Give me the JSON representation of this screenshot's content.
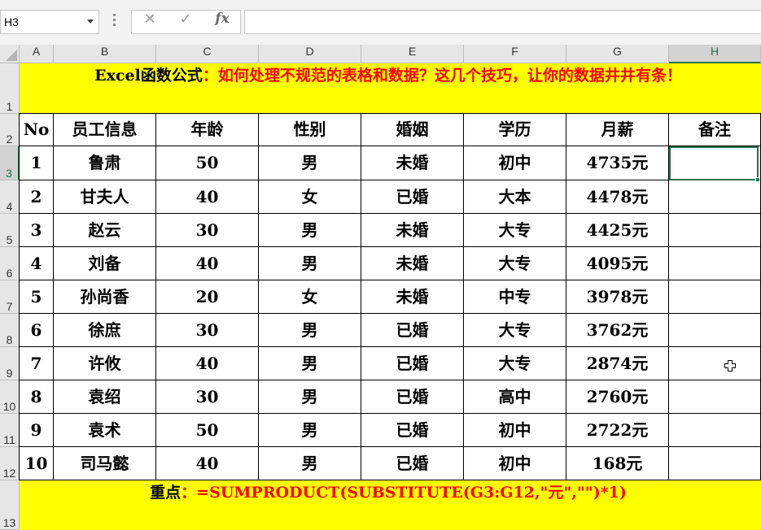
{
  "formula_bar": {
    "name_box": "H3",
    "formula": ""
  },
  "columns": [
    "A",
    "B",
    "C",
    "D",
    "E",
    "F",
    "G",
    "H"
  ],
  "rows": [
    "1",
    "2",
    "3",
    "4",
    "5",
    "6",
    "7",
    "8",
    "9",
    "10",
    "11",
    "12",
    "13"
  ],
  "title": {
    "prefix": "Excel函数公式",
    "text": "：如何处理不规范的表格和数据？这几个技巧，让你的数据井井有条！"
  },
  "table": {
    "headers": [
      "No",
      "员工信息",
      "年龄",
      "性别",
      "婚姻",
      "学历",
      "月薪",
      "备注"
    ],
    "rows": [
      [
        "1",
        "鲁肃",
        "50",
        "男",
        "未婚",
        "初中",
        "4735元",
        ""
      ],
      [
        "2",
        "甘夫人",
        "40",
        "女",
        "已婚",
        "大本",
        "4478元",
        ""
      ],
      [
        "3",
        "赵云",
        "30",
        "男",
        "未婚",
        "大专",
        "4425元",
        ""
      ],
      [
        "4",
        "刘备",
        "40",
        "男",
        "未婚",
        "大专",
        "4095元",
        ""
      ],
      [
        "5",
        "孙尚香",
        "20",
        "女",
        "未婚",
        "中专",
        "3978元",
        ""
      ],
      [
        "6",
        "徐庶",
        "30",
        "男",
        "已婚",
        "大专",
        "3762元",
        ""
      ],
      [
        "7",
        "许攸",
        "40",
        "男",
        "已婚",
        "大专",
        "2874元",
        ""
      ],
      [
        "8",
        "袁绍",
        "30",
        "男",
        "已婚",
        "高中",
        "2760元",
        ""
      ],
      [
        "9",
        "袁术",
        "50",
        "男",
        "已婚",
        "初中",
        "2722元",
        ""
      ],
      [
        "10",
        "司马懿",
        "40",
        "男",
        "已婚",
        "初中",
        "168元",
        ""
      ]
    ]
  },
  "note": {
    "label": "重点",
    "text": "：=SUMPRODUCT(SUBSTITUTE(G3:G12,\"元\",\"\")*1)"
  },
  "colors": {
    "band": "#ffff00",
    "accent_text": "#ff0000",
    "selection": "#217346"
  },
  "icons": {
    "cancel": "close-icon",
    "enter": "check-icon",
    "function": "fx-icon",
    "cursor": "cross-cursor-icon"
  }
}
